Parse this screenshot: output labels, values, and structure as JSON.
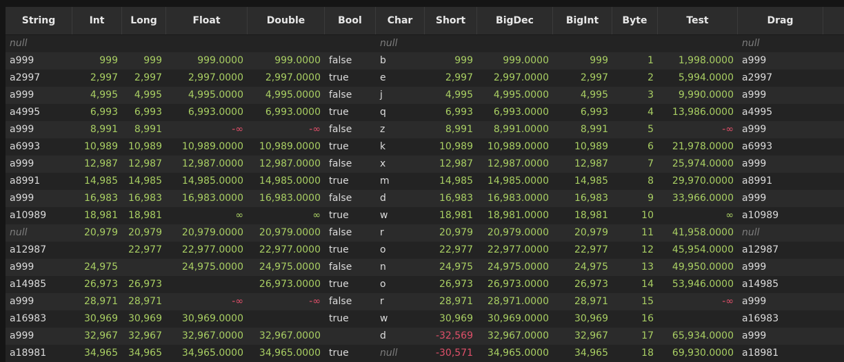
{
  "columns": [
    "String",
    "Int",
    "Long",
    "Float",
    "Double",
    "Bool",
    "Char",
    "Short",
    "BigDec",
    "BigInt",
    "Byte",
    "Test",
    "Drag"
  ],
  "colors": {
    "background": "#151515",
    "header": "#2c2c2c",
    "row_odd": "#232323",
    "row_even": "#2b2b2b",
    "number": "#a9cf63",
    "negative": "#e0506a",
    "null": "#7d7d7d"
  },
  "rows": [
    [
      "null",
      "",
      "",
      "",
      "",
      "",
      "null",
      "",
      "",
      "",
      "",
      "",
      "null"
    ],
    [
      "a999",
      "999",
      "999",
      "999.0000",
      "999.0000",
      "false",
      "b",
      "999",
      "999.0000",
      "999",
      "1",
      "1,998.0000",
      "a999"
    ],
    [
      "a2997",
      "2,997",
      "2,997",
      "2,997.0000",
      "2,997.0000",
      "true",
      "e",
      "2,997",
      "2,997.0000",
      "2,997",
      "2",
      "5,994.0000",
      "a2997"
    ],
    [
      "a999",
      "4,995",
      "4,995",
      "4,995.0000",
      "4,995.0000",
      "false",
      "j",
      "4,995",
      "4,995.0000",
      "4,995",
      "3",
      "9,990.0000",
      "a999"
    ],
    [
      "a4995",
      "6,993",
      "6,993",
      "6,993.0000",
      "6,993.0000",
      "true",
      "q",
      "6,993",
      "6,993.0000",
      "6,993",
      "4",
      "13,986.0000",
      "a4995"
    ],
    [
      "a999",
      "8,991",
      "8,991",
      "-∞",
      "-∞",
      "false",
      "z",
      "8,991",
      "8,991.0000",
      "8,991",
      "5",
      "-∞",
      "a999"
    ],
    [
      "a6993",
      "10,989",
      "10,989",
      "10,989.0000",
      "10,989.0000",
      "true",
      "k",
      "10,989",
      "10,989.0000",
      "10,989",
      "6",
      "21,978.0000",
      "a6993"
    ],
    [
      "a999",
      "12,987",
      "12,987",
      "12,987.0000",
      "12,987.0000",
      "false",
      "x",
      "12,987",
      "12,987.0000",
      "12,987",
      "7",
      "25,974.0000",
      "a999"
    ],
    [
      "a8991",
      "14,985",
      "14,985",
      "14,985.0000",
      "14,985.0000",
      "true",
      "m",
      "14,985",
      "14,985.0000",
      "14,985",
      "8",
      "29,970.0000",
      "a8991"
    ],
    [
      "a999",
      "16,983",
      "16,983",
      "16,983.0000",
      "16,983.0000",
      "false",
      "d",
      "16,983",
      "16,983.0000",
      "16,983",
      "9",
      "33,966.0000",
      "a999"
    ],
    [
      "a10989",
      "18,981",
      "18,981",
      "∞",
      "∞",
      "true",
      "w",
      "18,981",
      "18,981.0000",
      "18,981",
      "10",
      "∞",
      "a10989"
    ],
    [
      "null",
      "20,979",
      "20,979",
      "20,979.0000",
      "20,979.0000",
      "false",
      "r",
      "20,979",
      "20,979.0000",
      "20,979",
      "11",
      "41,958.0000",
      "null"
    ],
    [
      "a12987",
      "",
      "22,977",
      "22,977.0000",
      "22,977.0000",
      "true",
      "o",
      "22,977",
      "22,977.0000",
      "22,977",
      "12",
      "45,954.0000",
      "a12987"
    ],
    [
      "a999",
      "24,975",
      "",
      "24,975.0000",
      "24,975.0000",
      "false",
      "n",
      "24,975",
      "24,975.0000",
      "24,975",
      "13",
      "49,950.0000",
      "a999"
    ],
    [
      "a14985",
      "26,973",
      "26,973",
      "",
      "26,973.0000",
      "true",
      "o",
      "26,973",
      "26,973.0000",
      "26,973",
      "14",
      "53,946.0000",
      "a14985"
    ],
    [
      "a999",
      "28,971",
      "28,971",
      "-∞",
      "-∞",
      "false",
      "r",
      "28,971",
      "28,971.0000",
      "28,971",
      "15",
      "-∞",
      "a999"
    ],
    [
      "a16983",
      "30,969",
      "30,969",
      "30,969.0000",
      "",
      "true",
      "w",
      "30,969",
      "30,969.0000",
      "30,969",
      "16",
      "",
      "a16983"
    ],
    [
      "a999",
      "32,967",
      "32,967",
      "32,967.0000",
      "32,967.0000",
      "",
      "d",
      "-32,569",
      "32,967.0000",
      "32,967",
      "17",
      "65,934.0000",
      "a999"
    ],
    [
      "a18981",
      "34,965",
      "34,965",
      "34,965.0000",
      "34,965.0000",
      "true",
      "null",
      "-30,571",
      "34,965.0000",
      "34,965",
      "18",
      "69,930.0000",
      "a18981"
    ]
  ]
}
